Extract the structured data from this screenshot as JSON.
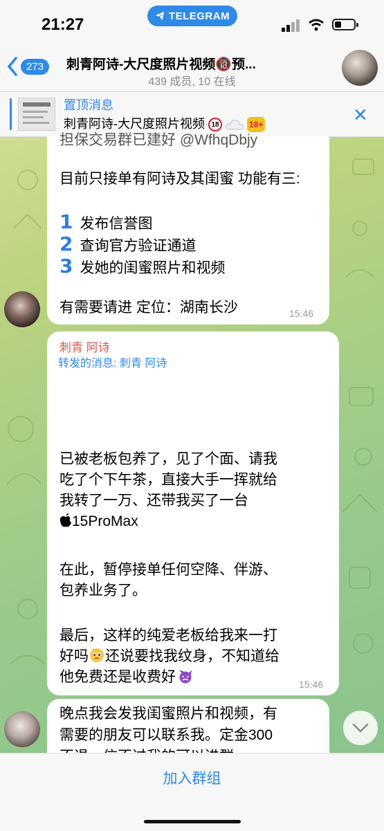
{
  "status": {
    "time": "21:27",
    "app_pill": "TELEGRAM"
  },
  "header": {
    "back_count": "273",
    "title": "刺青阿诗-大尺度照片视频🔞预...",
    "subtitle": "439 成员, 10 在线"
  },
  "pinned": {
    "label": "置顶消息",
    "text": "刺青阿诗-大尺度照片视频",
    "badge_18": "18",
    "badge_18plus": "18+"
  },
  "messages": [
    {
      "partial_top": "担保交易群已建好 @WfhqDbjy",
      "intro": "目前只接单有阿诗及其闺蜜 功能有三:",
      "items": [
        {
          "num": "1",
          "text": "发布信誉图"
        },
        {
          "num": "2",
          "text": "查询官方验证通道"
        },
        {
          "num": "3",
          "text": "发她的闺蜜照片和视频"
        }
      ],
      "closing": "有需要请进 定位：湖南长沙",
      "time": "15:46"
    },
    {
      "sender": "刺青 阿诗",
      "forwarded": "转发的消息: 刺青 阿诗",
      "para1": [
        "已被老板包养了，见了个面、请我",
        "吃了个下午茶，直接大手一挥就给",
        "我转了一万、还带我买了一台",
        "15ProMax"
      ],
      "para2": [
        "在此，暂停接单任何空降、伴游、",
        "包养业务了。"
      ],
      "para3": [
        "最后，这样的纯爱老板给我来一打",
        "好吗",
        "还说要找我纹身，不知道给",
        "他免费还是收费好"
      ],
      "time": "15:46"
    },
    {
      "lines": [
        "晚点我会发我闺蜜照片和视频，有",
        "需要的朋友可以联系我。定金300",
        "不退，信不过我的可以进群"
      ]
    }
  ],
  "bottom": {
    "join_label": "加入群组"
  }
}
